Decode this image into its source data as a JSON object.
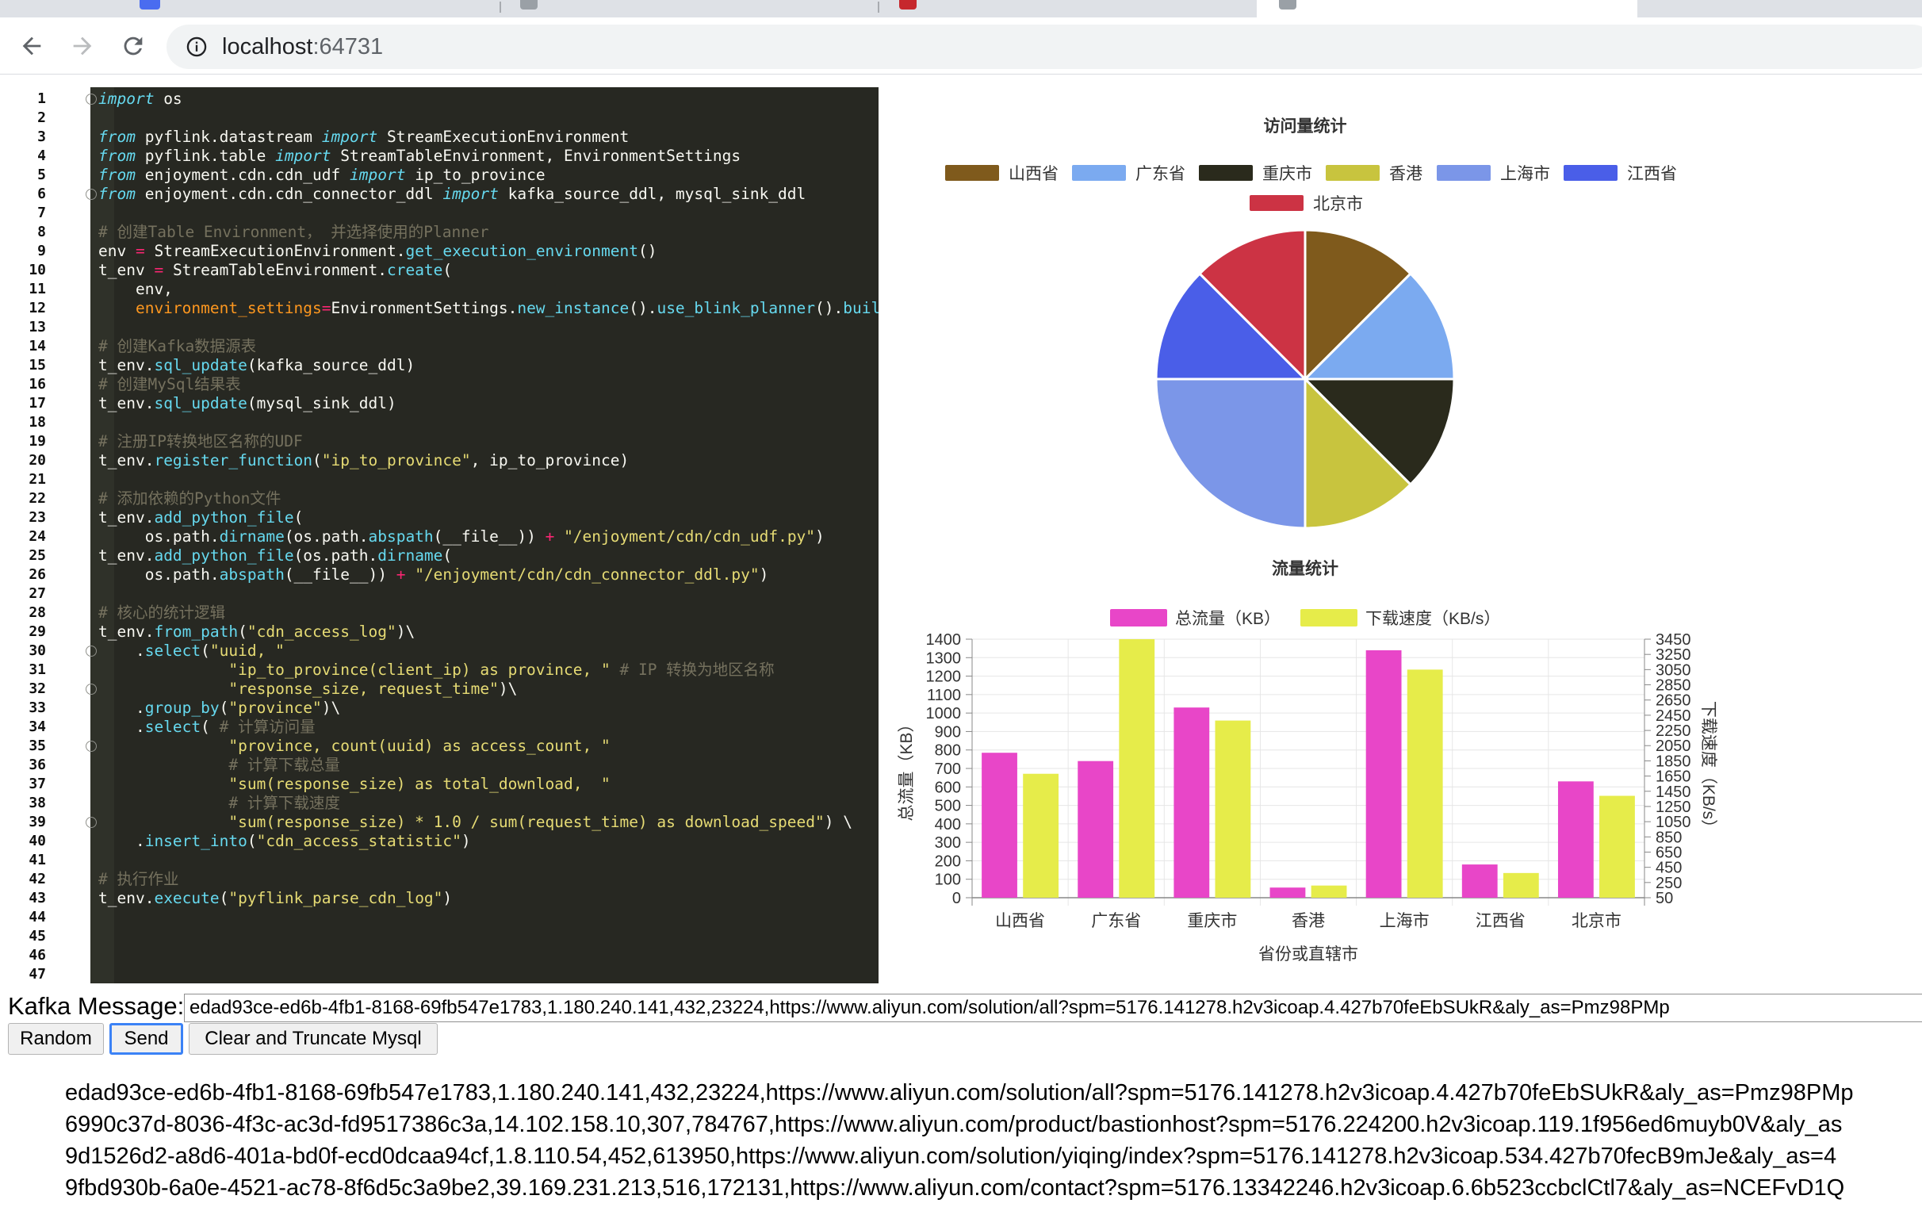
{
  "browser": {
    "url_host": "localhost",
    "url_port": ":64731"
  },
  "editor": {
    "lines": [
      [
        [
          "kw",
          "import"
        ],
        [
          "t",
          " os"
        ]
      ],
      [],
      [
        [
          "kw",
          "from"
        ],
        [
          "t",
          " pyflink.datastream "
        ],
        [
          "kw",
          "import"
        ],
        [
          "t",
          " StreamExecutionEnvironment"
        ]
      ],
      [
        [
          "kw",
          "from"
        ],
        [
          "t",
          " pyflink.table "
        ],
        [
          "kw",
          "import"
        ],
        [
          "t",
          " StreamTableEnvironment, EnvironmentSettings"
        ]
      ],
      [
        [
          "kw",
          "from"
        ],
        [
          "t",
          " enjoyment.cdn.cdn_udf "
        ],
        [
          "kw",
          "import"
        ],
        [
          "t",
          " ip_to_province"
        ]
      ],
      [
        [
          "kw",
          "from"
        ],
        [
          "t",
          " enjoyment.cdn.cdn_connector_ddl "
        ],
        [
          "kw",
          "import"
        ],
        [
          "t",
          " kafka_source_ddl, mysql_sink_ddl"
        ]
      ],
      [],
      [
        [
          "cm",
          "# 创建Table Environment， 并选择使用的Planner"
        ]
      ],
      [
        [
          "t",
          "env "
        ],
        [
          "op",
          "="
        ],
        [
          "t",
          " StreamExecutionEnvironment."
        ],
        [
          "fn",
          "get_execution_environment"
        ],
        [
          "t",
          "()"
        ]
      ],
      [
        [
          "t",
          "t_env "
        ],
        [
          "op",
          "="
        ],
        [
          "t",
          " StreamTableEnvironment."
        ],
        [
          "fn",
          "create"
        ],
        [
          "t",
          "("
        ]
      ],
      [
        [
          "t",
          "    env,"
        ]
      ],
      [
        [
          "arg",
          "    environment_settings"
        ],
        [
          "op",
          "="
        ],
        [
          "t",
          "EnvironmentSettings."
        ],
        [
          "fn",
          "new_instance"
        ],
        [
          "t",
          "()."
        ],
        [
          "fn",
          "use_blink_planner"
        ],
        [
          "t",
          "()."
        ],
        [
          "fn",
          "build"
        ],
        [
          "t",
          "())"
        ]
      ],
      [],
      [
        [
          "cm",
          "# 创建Kafka数据源表"
        ]
      ],
      [
        [
          "t",
          "t_env."
        ],
        [
          "fn",
          "sql_update"
        ],
        [
          "t",
          "(kafka_source_ddl)"
        ]
      ],
      [
        [
          "cm",
          "# 创建MySql结果表"
        ]
      ],
      [
        [
          "t",
          "t_env."
        ],
        [
          "fn",
          "sql_update"
        ],
        [
          "t",
          "(mysql_sink_ddl)"
        ]
      ],
      [],
      [
        [
          "cm",
          "# 注册IP转换地区名称的UDF"
        ]
      ],
      [
        [
          "t",
          "t_env."
        ],
        [
          "fn",
          "register_function"
        ],
        [
          "t",
          "("
        ],
        [
          "str",
          "\"ip_to_province\""
        ],
        [
          "t",
          ", ip_to_province)"
        ]
      ],
      [],
      [
        [
          "cm",
          "# 添加依赖的Python文件"
        ]
      ],
      [
        [
          "t",
          "t_env."
        ],
        [
          "fn",
          "add_python_file"
        ],
        [
          "t",
          "("
        ]
      ],
      [
        [
          "t",
          "     os.path."
        ],
        [
          "fn",
          "dirname"
        ],
        [
          "t",
          "(os.path."
        ],
        [
          "fn",
          "abspath"
        ],
        [
          "t",
          "(__file__)) "
        ],
        [
          "op",
          "+"
        ],
        [
          "t",
          " "
        ],
        [
          "str",
          "\"/enjoyment/cdn/cdn_udf.py\""
        ],
        [
          "t",
          ")"
        ]
      ],
      [
        [
          "t",
          "t_env."
        ],
        [
          "fn",
          "add_python_file"
        ],
        [
          "t",
          "(os.path."
        ],
        [
          "fn",
          "dirname"
        ],
        [
          "t",
          "("
        ]
      ],
      [
        [
          "t",
          "     os.path."
        ],
        [
          "fn",
          "abspath"
        ],
        [
          "t",
          "(__file__)) "
        ],
        [
          "op",
          "+"
        ],
        [
          "t",
          " "
        ],
        [
          "str",
          "\"/enjoyment/cdn/cdn_connector_ddl.py\""
        ],
        [
          "t",
          ")"
        ]
      ],
      [],
      [
        [
          "cm",
          "# 核心的统计逻辑"
        ]
      ],
      [
        [
          "t",
          "t_env."
        ],
        [
          "fn",
          "from_path"
        ],
        [
          "t",
          "("
        ],
        [
          "str",
          "\"cdn_access_log\""
        ],
        [
          "t",
          ")\\"
        ]
      ],
      [
        [
          "t",
          "    ."
        ],
        [
          "fn",
          "select"
        ],
        [
          "t",
          "("
        ],
        [
          "str",
          "\"uuid, \""
        ]
      ],
      [
        [
          "t",
          "              "
        ],
        [
          "str",
          "\"ip_to_province(client_ip) as province, \""
        ],
        [
          "t",
          " "
        ],
        [
          "cm",
          "# IP 转换为地区名称"
        ]
      ],
      [
        [
          "t",
          "              "
        ],
        [
          "str",
          "\"response_size, request_time\""
        ],
        [
          "t",
          ")\\"
        ]
      ],
      [
        [
          "t",
          "    ."
        ],
        [
          "fn",
          "group_by"
        ],
        [
          "t",
          "("
        ],
        [
          "str",
          "\"province\""
        ],
        [
          "t",
          ")\\"
        ]
      ],
      [
        [
          "t",
          "    ."
        ],
        [
          "fn",
          "select"
        ],
        [
          "t",
          "( "
        ],
        [
          "cm",
          "# 计算访问量"
        ]
      ],
      [
        [
          "t",
          "              "
        ],
        [
          "str",
          "\"province, count(uuid) as access_count, \""
        ]
      ],
      [
        [
          "t",
          "              "
        ],
        [
          "cm",
          "# 计算下载总量"
        ]
      ],
      [
        [
          "t",
          "              "
        ],
        [
          "str",
          "\"sum(response_size) as total_download,  \""
        ]
      ],
      [
        [
          "t",
          "              "
        ],
        [
          "cm",
          "# 计算下载速度"
        ]
      ],
      [
        [
          "t",
          "              "
        ],
        [
          "str",
          "\"sum(response_size) * 1.0 / sum(request_time) as download_speed\""
        ],
        [
          "t",
          ") \\"
        ]
      ],
      [
        [
          "t",
          "    ."
        ],
        [
          "fn",
          "insert_into"
        ],
        [
          "t",
          "("
        ],
        [
          "str",
          "\"cdn_access_statistic\""
        ],
        [
          "t",
          ")"
        ]
      ],
      [],
      [
        [
          "cm",
          "# 执行作业"
        ]
      ],
      [
        [
          "t",
          "t_env."
        ],
        [
          "fn",
          "execute"
        ],
        [
          "t",
          "("
        ],
        [
          "str",
          "\"pyflink_parse_cdn_log\""
        ],
        [
          "t",
          ")"
        ]
      ],
      [],
      [],
      [],
      []
    ],
    "fold_lines": [
      1,
      6,
      30,
      32,
      35,
      39
    ]
  },
  "chart_data": [
    {
      "type": "pie",
      "title": "访问量统计",
      "legend_position": "top",
      "categories": [
        "山西省",
        "广东省",
        "重庆市",
        "香港",
        "上海市",
        "江西省",
        "北京市"
      ],
      "values": [
        12,
        12,
        12,
        12,
        24,
        12,
        12
      ],
      "colors": [
        "#7f5a1c",
        "#7baaf0",
        "#2a2a1c",
        "#c8c43e",
        "#7b96e8",
        "#4a5ee8",
        "#cc3344"
      ]
    },
    {
      "type": "bar",
      "title": "流量统计",
      "legend_position": "top",
      "xlabel": "省份或直辖市",
      "ylabel": "总流量（KB）",
      "y2label": "下载速度（KB/s）",
      "categories": [
        "山西省",
        "广东省",
        "重庆市",
        "香港",
        "上海市",
        "江西省",
        "北京市"
      ],
      "ylim": [
        0,
        1400
      ],
      "y_ticks": [
        0,
        100,
        200,
        300,
        400,
        500,
        600,
        700,
        800,
        900,
        1000,
        1100,
        1200,
        1300,
        1400
      ],
      "y2lim": [
        50,
        3450
      ],
      "y2_ticks": [
        50,
        250,
        450,
        650,
        850,
        1050,
        1250,
        1450,
        1650,
        1850,
        2050,
        2250,
        2450,
        2650,
        2850,
        3050,
        3250,
        3450
      ],
      "grid": true,
      "series": [
        {
          "name": "总流量（KB）",
          "axis": "left",
          "color": "#e846c8",
          "values": [
            785,
            740,
            1030,
            55,
            1340,
            180,
            630
          ]
        },
        {
          "name": "下载速度（KB/s）",
          "axis": "right",
          "color": "#e6ec4a",
          "values": [
            1680,
            3450,
            2380,
            210,
            3050,
            375,
            1390
          ]
        }
      ]
    }
  ],
  "form": {
    "label": "Kafka Message:",
    "input_value": "edad93ce-ed6b-4fb1-8168-69fb547e1783,1.180.240.141,432,23224,https://www.aliyun.com/solution/all?spm=5176.141278.h2v3icoap.4.427b70feEbSUkR&aly_as=Pmz98PMp",
    "random_label": "Random",
    "send_label": "Send",
    "clear_label": "Clear and Truncate Mysql"
  },
  "messages": [
    "edad93ce-ed6b-4fb1-8168-69fb547e1783,1.180.240.141,432,23224,https://www.aliyun.com/solution/all?spm=5176.141278.h2v3icoap.4.427b70feEbSUkR&aly_as=Pmz98PMp",
    "6990c37d-8036-4f3c-ac3d-fd9517386c3a,14.102.158.10,307,784767,https://www.aliyun.com/product/bastionhost?spm=5176.224200.h2v3icoap.119.1f956ed6muyb0V&aly_as",
    "9d1526d2-a8d6-401a-bd0f-ecd0dcaa94cf,1.8.110.54,452,613950,https://www.aliyun.com/solution/yiqing/index?spm=5176.141278.h2v3icoap.534.427b70fecB9mJe&aly_as=4",
    "9fbd930b-6a0e-4521-ac78-8f6d5c3a9be2,39.169.231.213,516,172131,https://www.aliyun.com/contact?spm=5176.13342246.h2v3icoap.6.6b523ccbclCtl7&aly_as=NCEFvD1Q"
  ]
}
